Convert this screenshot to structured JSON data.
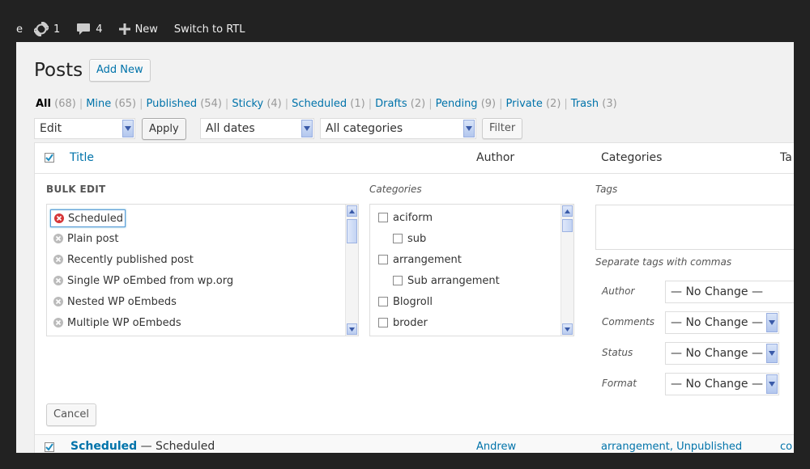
{
  "adminbar": {
    "site_fragment": "e",
    "updates_count": "1",
    "comments_count": "4",
    "new_label": "New",
    "rtl_label": "Switch to RTL"
  },
  "page": {
    "title": "Posts",
    "add_new_label": "Add New"
  },
  "views": [
    {
      "label": "All",
      "count": "(68)"
    },
    {
      "label": "Mine",
      "count": "(65)"
    },
    {
      "label": "Published",
      "count": "(54)"
    },
    {
      "label": "Sticky",
      "count": "(4)"
    },
    {
      "label": "Scheduled",
      "count": "(1)"
    },
    {
      "label": "Drafts",
      "count": "(2)"
    },
    {
      "label": "Pending",
      "count": "(9)"
    },
    {
      "label": "Private",
      "count": "(2)"
    },
    {
      "label": "Trash",
      "count": "(3)"
    }
  ],
  "filters": {
    "bulk_action": "Edit",
    "apply_label": "Apply",
    "dates": "All dates",
    "categories": "All categories",
    "filter_label": "Filter"
  },
  "columns": {
    "title": "Title",
    "author": "Author",
    "categories": "Categories",
    "tags": "Ta"
  },
  "bulk_edit": {
    "heading": "BULK EDIT",
    "posts": [
      "Scheduled",
      "Plain post",
      "Recently published post",
      "Single WP oEmbed from wp.org",
      "Nested WP oEmbeds",
      "Multiple WP oEmbeds"
    ],
    "categories_label": "Categories",
    "categories": [
      {
        "name": "aciform",
        "child": false
      },
      {
        "name": "sub",
        "child": true
      },
      {
        "name": "arrangement",
        "child": false
      },
      {
        "name": "Sub arrangement",
        "child": true
      },
      {
        "name": "Blogroll",
        "child": false
      },
      {
        "name": "broder",
        "child": false
      }
    ],
    "tags_label": "Tags",
    "tags_hint": "Separate tags with commas",
    "fields": {
      "author_label": "Author",
      "author_value": "— No Change —",
      "comments_label": "Comments",
      "comments_value": "— No Change —",
      "status_label": "Status",
      "status_value": "— No Change —",
      "format_label": "Format",
      "format_value": "— No Change —"
    },
    "cancel_label": "Cancel"
  },
  "row": {
    "title": "Scheduled",
    "state": "— Scheduled",
    "author": "Andrew",
    "categories": "arrangement, Unpublished",
    "tags": "co"
  }
}
